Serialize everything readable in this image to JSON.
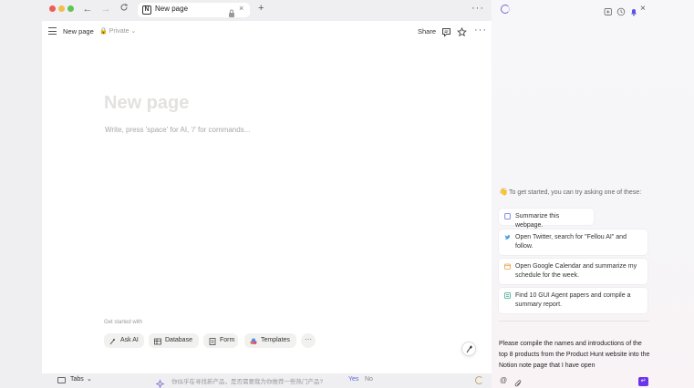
{
  "browser": {
    "tab_title": "New page",
    "tab_close": "×",
    "tab_add": "+",
    "more": "···",
    "back": "←",
    "forward": "→"
  },
  "notion": {
    "breadcrumb": "New page",
    "privacy": "Private",
    "share_label": "Share",
    "more": "···",
    "page_title_placeholder": "New page",
    "body_placeholder": "Write, press 'space' for AI, '/' for commands...",
    "get_started_label": "Get started with",
    "chips": [
      {
        "label": "Ask AI",
        "icon": "ai-sparkle-icon"
      },
      {
        "label": "Database",
        "icon": "table-icon"
      },
      {
        "label": "Form",
        "icon": "form-icon"
      },
      {
        "label": "Templates",
        "icon": "templates-icon"
      }
    ],
    "chip_more": "···"
  },
  "bottombar": {
    "tabs_label": "Tabs",
    "suggestion": "你似乎在寻找新产品，是否需要我为你推荐一些热门产品?",
    "yes": "Yes",
    "no": "No"
  },
  "panel": {
    "hint": "To get started, you can try asking one of these:",
    "hint_emoji": "👋",
    "suggestions": [
      {
        "text": "Summarize this webpage.",
        "icon": "document-icon",
        "color": "#5c6ae0"
      },
      {
        "text": "Open Twitter, search for \"Fellou AI\" and follow.",
        "icon": "twitter-icon",
        "color": "#4a9fe8"
      },
      {
        "text": "Open Google Calendar and summarize my schedule for the week.",
        "icon": "calendar-icon",
        "color": "#e8a040"
      },
      {
        "text": "Find 10 GUI Agent papers and compile a summary report.",
        "icon": "report-icon",
        "color": "#3aa58e"
      }
    ],
    "prompt": "Please compile the names and introductions of the top 8 products from the Product Hunt website into the Notion note page that I have open",
    "at": "@",
    "send": "↵"
  },
  "colors": {
    "accent": "#6a35e8",
    "traffic_red": "#ee5c56",
    "traffic_yellow": "#f4bd4f",
    "traffic_green": "#5fc553"
  }
}
